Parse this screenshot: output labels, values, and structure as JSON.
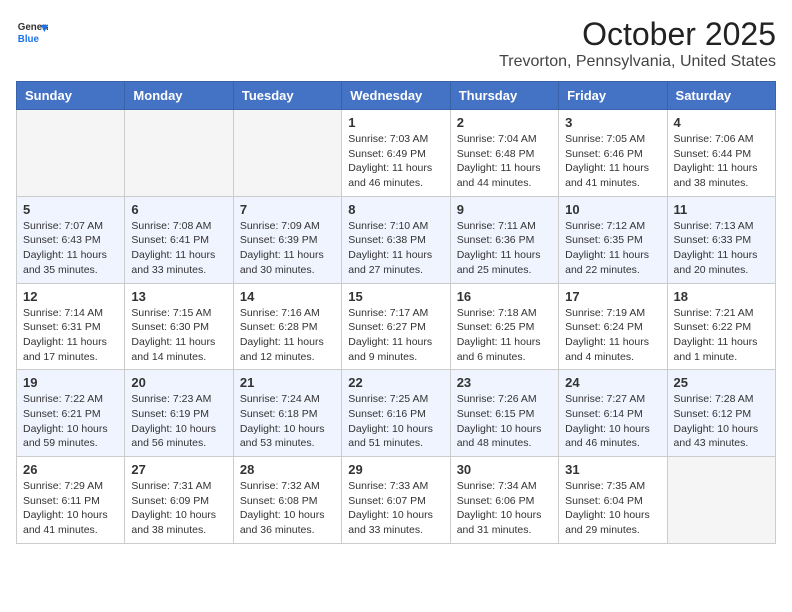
{
  "header": {
    "logo": {
      "general": "General",
      "blue": "Blue"
    },
    "title": "October 2025",
    "subtitle": "Trevorton, Pennsylvania, United States"
  },
  "calendar": {
    "days_of_week": [
      "Sunday",
      "Monday",
      "Tuesday",
      "Wednesday",
      "Thursday",
      "Friday",
      "Saturday"
    ],
    "weeks": [
      [
        {
          "day": "",
          "info": ""
        },
        {
          "day": "",
          "info": ""
        },
        {
          "day": "",
          "info": ""
        },
        {
          "day": "1",
          "info": "Sunrise: 7:03 AM\nSunset: 6:49 PM\nDaylight: 11 hours and 46 minutes."
        },
        {
          "day": "2",
          "info": "Sunrise: 7:04 AM\nSunset: 6:48 PM\nDaylight: 11 hours and 44 minutes."
        },
        {
          "day": "3",
          "info": "Sunrise: 7:05 AM\nSunset: 6:46 PM\nDaylight: 11 hours and 41 minutes."
        },
        {
          "day": "4",
          "info": "Sunrise: 7:06 AM\nSunset: 6:44 PM\nDaylight: 11 hours and 38 minutes."
        }
      ],
      [
        {
          "day": "5",
          "info": "Sunrise: 7:07 AM\nSunset: 6:43 PM\nDaylight: 11 hours and 35 minutes."
        },
        {
          "day": "6",
          "info": "Sunrise: 7:08 AM\nSunset: 6:41 PM\nDaylight: 11 hours and 33 minutes."
        },
        {
          "day": "7",
          "info": "Sunrise: 7:09 AM\nSunset: 6:39 PM\nDaylight: 11 hours and 30 minutes."
        },
        {
          "day": "8",
          "info": "Sunrise: 7:10 AM\nSunset: 6:38 PM\nDaylight: 11 hours and 27 minutes."
        },
        {
          "day": "9",
          "info": "Sunrise: 7:11 AM\nSunset: 6:36 PM\nDaylight: 11 hours and 25 minutes."
        },
        {
          "day": "10",
          "info": "Sunrise: 7:12 AM\nSunset: 6:35 PM\nDaylight: 11 hours and 22 minutes."
        },
        {
          "day": "11",
          "info": "Sunrise: 7:13 AM\nSunset: 6:33 PM\nDaylight: 11 hours and 20 minutes."
        }
      ],
      [
        {
          "day": "12",
          "info": "Sunrise: 7:14 AM\nSunset: 6:31 PM\nDaylight: 11 hours and 17 minutes."
        },
        {
          "day": "13",
          "info": "Sunrise: 7:15 AM\nSunset: 6:30 PM\nDaylight: 11 hours and 14 minutes."
        },
        {
          "day": "14",
          "info": "Sunrise: 7:16 AM\nSunset: 6:28 PM\nDaylight: 11 hours and 12 minutes."
        },
        {
          "day": "15",
          "info": "Sunrise: 7:17 AM\nSunset: 6:27 PM\nDaylight: 11 hours and 9 minutes."
        },
        {
          "day": "16",
          "info": "Sunrise: 7:18 AM\nSunset: 6:25 PM\nDaylight: 11 hours and 6 minutes."
        },
        {
          "day": "17",
          "info": "Sunrise: 7:19 AM\nSunset: 6:24 PM\nDaylight: 11 hours and 4 minutes."
        },
        {
          "day": "18",
          "info": "Sunrise: 7:21 AM\nSunset: 6:22 PM\nDaylight: 11 hours and 1 minute."
        }
      ],
      [
        {
          "day": "19",
          "info": "Sunrise: 7:22 AM\nSunset: 6:21 PM\nDaylight: 10 hours and 59 minutes."
        },
        {
          "day": "20",
          "info": "Sunrise: 7:23 AM\nSunset: 6:19 PM\nDaylight: 10 hours and 56 minutes."
        },
        {
          "day": "21",
          "info": "Sunrise: 7:24 AM\nSunset: 6:18 PM\nDaylight: 10 hours and 53 minutes."
        },
        {
          "day": "22",
          "info": "Sunrise: 7:25 AM\nSunset: 6:16 PM\nDaylight: 10 hours and 51 minutes."
        },
        {
          "day": "23",
          "info": "Sunrise: 7:26 AM\nSunset: 6:15 PM\nDaylight: 10 hours and 48 minutes."
        },
        {
          "day": "24",
          "info": "Sunrise: 7:27 AM\nSunset: 6:14 PM\nDaylight: 10 hours and 46 minutes."
        },
        {
          "day": "25",
          "info": "Sunrise: 7:28 AM\nSunset: 6:12 PM\nDaylight: 10 hours and 43 minutes."
        }
      ],
      [
        {
          "day": "26",
          "info": "Sunrise: 7:29 AM\nSunset: 6:11 PM\nDaylight: 10 hours and 41 minutes."
        },
        {
          "day": "27",
          "info": "Sunrise: 7:31 AM\nSunset: 6:09 PM\nDaylight: 10 hours and 38 minutes."
        },
        {
          "day": "28",
          "info": "Sunrise: 7:32 AM\nSunset: 6:08 PM\nDaylight: 10 hours and 36 minutes."
        },
        {
          "day": "29",
          "info": "Sunrise: 7:33 AM\nSunset: 6:07 PM\nDaylight: 10 hours and 33 minutes."
        },
        {
          "day": "30",
          "info": "Sunrise: 7:34 AM\nSunset: 6:06 PM\nDaylight: 10 hours and 31 minutes."
        },
        {
          "day": "31",
          "info": "Sunrise: 7:35 AM\nSunset: 6:04 PM\nDaylight: 10 hours and 29 minutes."
        },
        {
          "day": "",
          "info": ""
        }
      ]
    ]
  }
}
